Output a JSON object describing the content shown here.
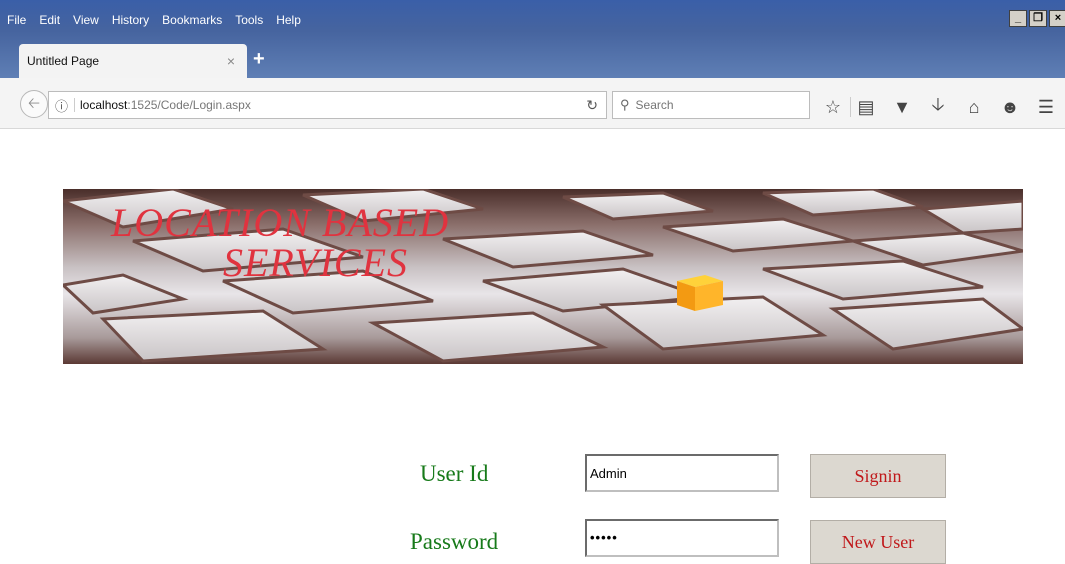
{
  "browser": {
    "menu": [
      "File",
      "Edit",
      "View",
      "History",
      "Bookmarks",
      "Tools",
      "Help"
    ],
    "tab_title": "Untitled Page",
    "tab_close": "×",
    "new_tab": "+",
    "url_host": "localhost",
    "url_path": ":1525/Code/Login.aspx",
    "search_placeholder": "Search"
  },
  "banner": {
    "line1": "LOCATION BASED",
    "line2": "SERVICES"
  },
  "login": {
    "user_label": "User Id",
    "user_value": "Admin",
    "password_label": "Password",
    "password_value": "•••••",
    "signin_label": "Signin",
    "newuser_label": "New User"
  },
  "colors": {
    "label_green": "#177a1a",
    "button_text_red": "#c0181a",
    "banner_text_red": "#e0333f",
    "chrome_blue": "#46649f"
  },
  "icons": [
    "back-icon",
    "info-icon",
    "reload-icon",
    "search-icon",
    "bookmark-star-icon",
    "reading-list-icon",
    "pocket-icon",
    "download-icon",
    "home-icon",
    "smiley-icon",
    "menu-icon"
  ]
}
